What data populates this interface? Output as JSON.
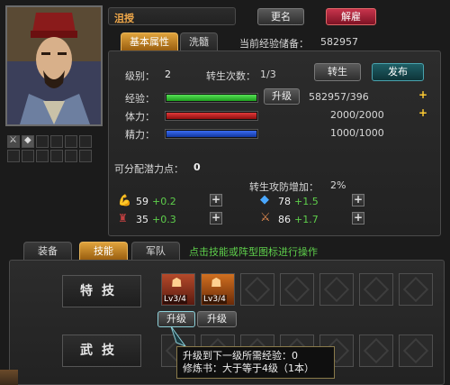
{
  "general": {
    "name": "沮授",
    "rename_label": "更名",
    "dismiss_label": "解雇"
  },
  "tabs_top": [
    {
      "label": "基本属性",
      "active": true
    },
    {
      "label": "洗髓",
      "active": false
    }
  ],
  "exp_storage": {
    "label": "当前经验储备：",
    "value": "582957"
  },
  "stats": {
    "level_label": "级别：",
    "level_value": "2",
    "rebirth_label": "转生次数：",
    "rebirth_value": "1/3",
    "rebirth_button": "转生",
    "publish_button": "发布",
    "exp_label": "经验：",
    "exp_value": "582957/396",
    "upgrade_button": "升级",
    "stamina_label": "体力：",
    "stamina_value": "2000/2000",
    "energy_label": "精力：",
    "energy_value": "1000/1000",
    "potential_label": "可分配潜力点：",
    "potential_value": "0",
    "rebirth_bonus_label": "转生攻防增加：",
    "rebirth_bonus_value": "2%",
    "plus_symbol": "+"
  },
  "attributes": [
    {
      "icon": "strength-icon",
      "value": "59",
      "bonus": "+0.2"
    },
    {
      "icon": "gem-icon",
      "value": "78",
      "bonus": "+1.5"
    },
    {
      "icon": "general-icon",
      "value": "35",
      "bonus": "+0.3"
    },
    {
      "icon": "sword-icon",
      "value": "86",
      "bonus": "+1.7"
    }
  ],
  "tabs_bottom": [
    {
      "label": "装备",
      "active": false
    },
    {
      "label": "技能",
      "active": true
    },
    {
      "label": "军队",
      "active": false
    }
  ],
  "hint": "点击技能或阵型图标进行操作",
  "skill_sections": [
    {
      "title": "特技",
      "skills": [
        "Lv3/4",
        "Lv3/4"
      ]
    },
    {
      "title": "武技",
      "skills": []
    }
  ],
  "skill_buttons": [
    "升级",
    "升级"
  ],
  "tooltip": {
    "line1": "升级到下一级所需经验：0",
    "line2": "修炼书：大于等于4级（1本）"
  },
  "colors": {
    "accent": "#e0a33c",
    "exp_bar": "#2fbf2f",
    "stamina_bar": "#c41a1a",
    "energy_bar": "#1f4fd6"
  }
}
